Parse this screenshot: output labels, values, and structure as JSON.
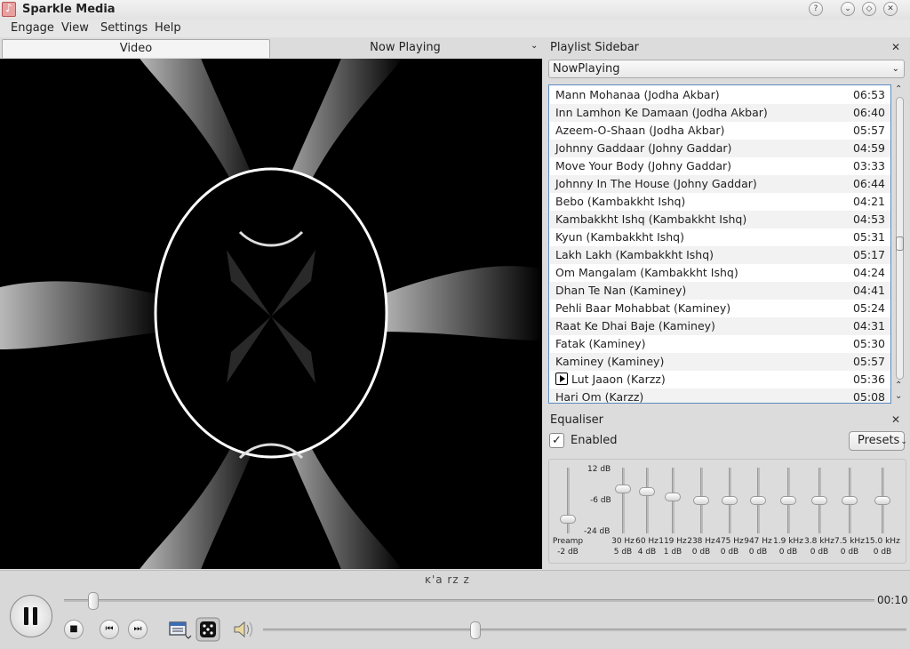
{
  "window": {
    "title": "Sparkle Media",
    "buttons": {
      "help": "?",
      "minimize": "⌄",
      "maximize": "◇",
      "close": "✕"
    }
  },
  "menu": [
    "Engage",
    "View",
    "Settings",
    "Help"
  ],
  "tabs": {
    "video": "Video",
    "now_playing": "Now Playing"
  },
  "playlist_sidebar": {
    "title": "Playlist Sidebar",
    "close": "✕",
    "selected_playlist": "NowPlaying",
    "tracks": [
      {
        "title": "Mann Mohanaa (Jodha Akbar)",
        "duration": "06:53"
      },
      {
        "title": "Inn Lamhon Ke Damaan (Jodha Akbar)",
        "duration": "06:40"
      },
      {
        "title": "Azeem-O-Shaan (Jodha Akbar)",
        "duration": "05:57"
      },
      {
        "title": "Johnny Gaddaar (Johny Gaddar)",
        "duration": "04:59"
      },
      {
        "title": "Move Your Body (Johny Gaddar)",
        "duration": "03:33"
      },
      {
        "title": "Johnny In The House (Johny Gaddar)",
        "duration": "06:44"
      },
      {
        "title": "Bebo (Kambakkht Ishq)",
        "duration": "04:21"
      },
      {
        "title": "Kambakkht Ishq (Kambakkht Ishq)",
        "duration": "04:53"
      },
      {
        "title": "Kyun (Kambakkht Ishq)",
        "duration": "05:31"
      },
      {
        "title": "Lakh Lakh (Kambakkht Ishq)",
        "duration": "05:17"
      },
      {
        "title": "Om Mangalam (Kambakkht Ishq)",
        "duration": "04:24"
      },
      {
        "title": "Dhan Te Nan (Kaminey)",
        "duration": "04:41"
      },
      {
        "title": "Pehli Baar Mohabbat (Kaminey)",
        "duration": "05:24"
      },
      {
        "title": "Raat Ke Dhai Baje (Kaminey)",
        "duration": "04:31"
      },
      {
        "title": "Fatak (Kaminey)",
        "duration": "05:30"
      },
      {
        "title": "Kaminey (Kaminey)",
        "duration": "05:57"
      },
      {
        "title": "Lut Jaaon (Karzz)",
        "duration": "05:36",
        "playing": true
      },
      {
        "title": "Hari Om (Karzz)",
        "duration": "05:08"
      }
    ]
  },
  "equaliser": {
    "title": "Equaliser",
    "close": "✕",
    "enabled_label": "Enabled",
    "enabled": true,
    "presets_label": "Presets",
    "scale": {
      "top": "12 dB",
      "mid": "-6 dB",
      "bottom": "-24 dB"
    },
    "preamp": {
      "label": "Preamp",
      "gain": "-2 dB",
      "level": 0.22
    },
    "bands": [
      {
        "freq": "30 Hz",
        "gain": "5 dB",
        "level": 0.67
      },
      {
        "freq": "60 Hz",
        "gain": "4 dB",
        "level": 0.64
      },
      {
        "freq": "119 Hz",
        "gain": "1 dB",
        "level": 0.56
      },
      {
        "freq": "238 Hz",
        "gain": "0 dB",
        "level": 0.5
      },
      {
        "freq": "475 Hz",
        "gain": "0 dB",
        "level": 0.5
      },
      {
        "freq": "947 Hz",
        "gain": "0 dB",
        "level": 0.5
      },
      {
        "freq": "1.9 kHz",
        "gain": "0 dB",
        "level": 0.5
      },
      {
        "freq": "3.8 kHz",
        "gain": "0 dB",
        "level": 0.5
      },
      {
        "freq": "7.5 kHz",
        "gain": "0 dB",
        "level": 0.5
      },
      {
        "freq": "15.0 kHz",
        "gain": "0 dB",
        "level": 0.5
      }
    ]
  },
  "player": {
    "now_playing_title": "ĸ'a rz z",
    "elapsed": "00:10",
    "position_fraction": 0.03,
    "volume_fraction": 0.33
  }
}
